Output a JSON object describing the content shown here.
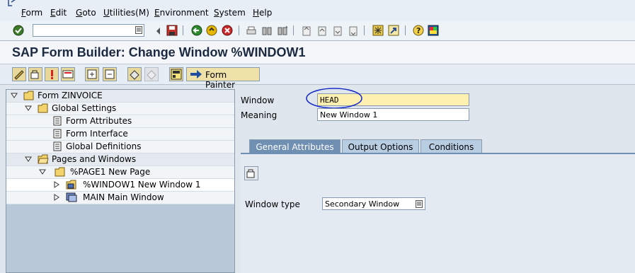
{
  "menu": {
    "items": [
      "Form",
      "Edit",
      "Goto",
      "Utilities(M)",
      "Environment",
      "System",
      "Help"
    ]
  },
  "toolbar": {
    "command_value": "",
    "icons": [
      "check-icon",
      "back-icon",
      "save-icon",
      "back-green-icon",
      "exit-icon",
      "cancel-icon",
      "print-icon",
      "find-icon",
      "find-next-icon",
      "first-page-icon",
      "prev-page-icon",
      "next-page-icon",
      "last-page-icon",
      "create-session-icon",
      "shortcut-icon",
      "help-icon",
      "layout-icon"
    ]
  },
  "title": "SAP Form Builder: Change Window %WINDOW1",
  "app_toolbar": {
    "form_painter_label": "Form Painter"
  },
  "tree": {
    "rows": [
      {
        "label": "Form ZINVOICE"
      },
      {
        "label": "Global Settings"
      },
      {
        "label": "Form Attributes"
      },
      {
        "label": "Form Interface"
      },
      {
        "label": "Global Definitions"
      },
      {
        "label": "Pages and Windows"
      },
      {
        "label": "%PAGE1 New Page"
      },
      {
        "label": "%WINDOW1  New Window 1"
      },
      {
        "label": "MAIN Main Window"
      }
    ]
  },
  "window_form": {
    "window_label": "Window",
    "window_value": "HEAD",
    "meaning_label": "Meaning",
    "meaning_value": "New Window 1"
  },
  "tabs": [
    "General Attributes",
    "Output Options",
    "Conditions"
  ],
  "general": {
    "window_type_label": "Window type",
    "window_type_value": "Secondary Window"
  },
  "colors": {
    "accent_orange": "#f0a040",
    "active_tab": "#6f8fb3",
    "highlight_field": "#fdf0b0",
    "annotation_circle": "#1a2fc8"
  }
}
